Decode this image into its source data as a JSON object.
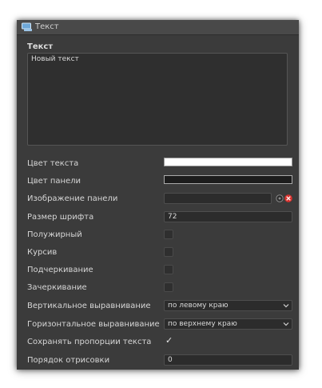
{
  "window": {
    "title": "Текст",
    "icon": "text-panel-icon"
  },
  "text_section": {
    "label": "Текст",
    "value": "Новый текст"
  },
  "properties": {
    "text_color": {
      "label": "Цвет текста",
      "color": "#ffffff"
    },
    "panel_color": {
      "label": "Цвет панели",
      "color": "#1d1d1d"
    },
    "panel_image": {
      "label": "Изображение панели",
      "value": ""
    },
    "font_size": {
      "label": "Размер шрифта",
      "value": "72"
    },
    "bold": {
      "label": "Полужирный",
      "checked": false
    },
    "italic": {
      "label": "Курсив",
      "checked": false
    },
    "underline": {
      "label": "Подчеркивание",
      "checked": false
    },
    "strikethrough": {
      "label": "Зачеркивание",
      "checked": false
    },
    "vertical_align": {
      "label": "Вертикальное выравнивание",
      "value": "по левому краю"
    },
    "horizontal_align": {
      "label": "Горизонтальное выравнивание",
      "value": "по верхнему краю"
    },
    "keep_proportions": {
      "label": "Сохранять пропорции текста",
      "checked": true,
      "mark": "✓"
    },
    "draw_order": {
      "label": "Порядок отрисовки",
      "value": "0"
    }
  }
}
